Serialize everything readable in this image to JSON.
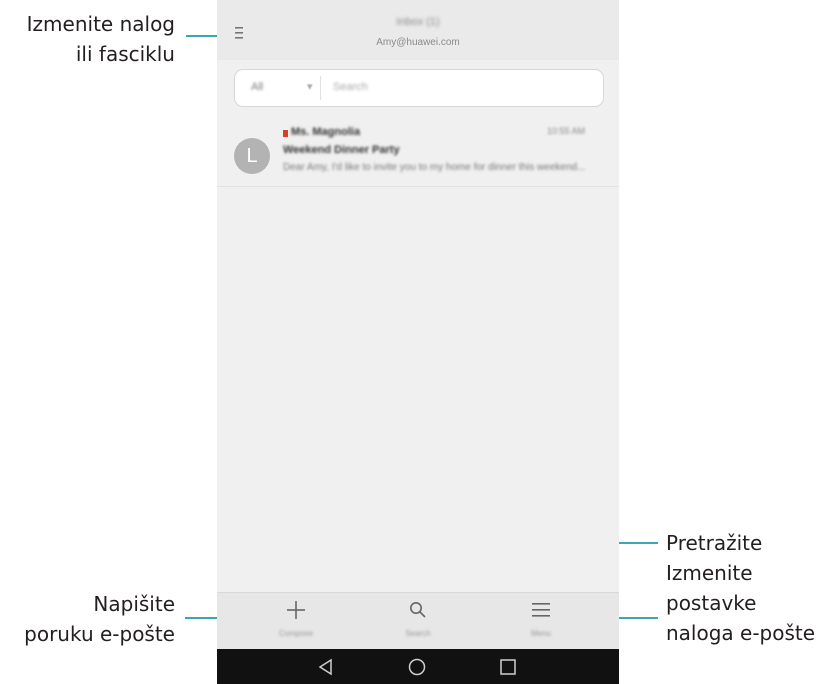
{
  "callouts": {
    "change_account": [
      "Izmenite nalog",
      "ili fasciklu"
    ],
    "write_email": [
      "Napišite",
      "poruku e-pošte"
    ],
    "search_settings": [
      "Pretražite",
      "Izmenite",
      "postavke",
      "naloga e-pošte"
    ]
  },
  "header": {
    "title": "Inbox (1)",
    "account": "Amy@huawei.com"
  },
  "search": {
    "filter_value": "All",
    "placeholder": "Search"
  },
  "messages": [
    {
      "avatar_letter": "L",
      "sender": "Ms. Magnolia",
      "date": "10:55 AM",
      "subject": "Weekend Dinner Party",
      "preview": "Dear Amy, I'd like to invite you to my home for dinner this weekend..."
    }
  ],
  "bottom_bar": {
    "compose_label": "Compose",
    "search_label": "Search",
    "menu_label": "Menu"
  },
  "colors": {
    "leader": "#3aa8b0",
    "flag": "#d9402b",
    "avatar": "#b3b3b3"
  }
}
